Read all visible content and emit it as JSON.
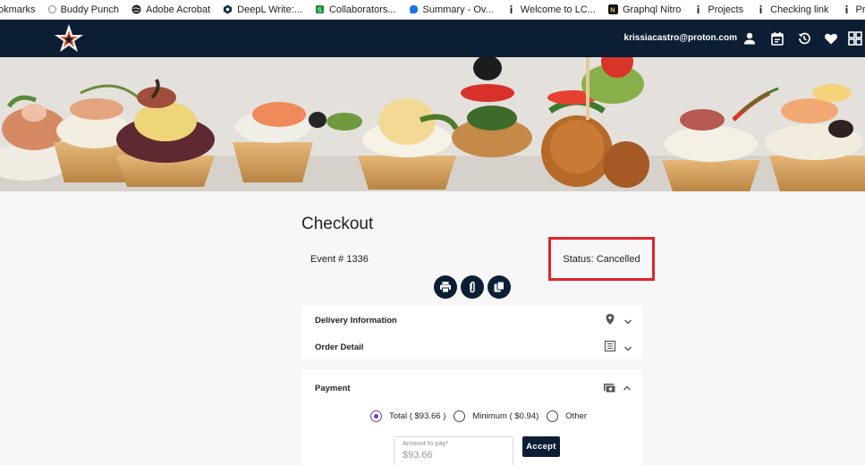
{
  "bookmarks": [
    {
      "label": "okmarks",
      "icon": "none",
      "color": ""
    },
    {
      "label": "Buddy Punch",
      "icon": "circle-icon",
      "color": "#8a8a8a"
    },
    {
      "label": "Adobe Acrobat",
      "icon": "globe-icon",
      "color": "#202124"
    },
    {
      "label": "DeepL Write:...",
      "icon": "deepl-icon",
      "color": "#0f2b46"
    },
    {
      "label": "Collaborators...",
      "icon": "collab-icon",
      "color": "#1e8e3e"
    },
    {
      "label": "Summary - Ov...",
      "icon": "summary-icon",
      "color": "#1a73e8"
    },
    {
      "label": "Welcome to LC...",
      "icon": "info-icon",
      "color": "#202124"
    },
    {
      "label": "Graphql Nitro",
      "icon": "nitro-icon",
      "color": "#111111"
    },
    {
      "label": "Projects",
      "icon": "info-icon",
      "color": "#202124"
    },
    {
      "label": "Checking link",
      "icon": "info-icon",
      "color": "#202124"
    },
    {
      "label": "Project Manag...",
      "icon": "info-icon",
      "color": "#202124"
    }
  ],
  "nav": {
    "user_email": "krissiacastro@proton.com",
    "brand_color": "#0b1e33"
  },
  "checkout": {
    "title": "Checkout",
    "event_number": "Event # 1336",
    "status": "Status: Cancelled",
    "status_highlight_color": "#e0242c"
  },
  "actions": [
    "print",
    "attachment",
    "copy"
  ],
  "panels": {
    "delivery": {
      "title": "Delivery Information"
    },
    "order": {
      "title": "Order Detail"
    },
    "payment": {
      "title": "Payment"
    }
  },
  "payment": {
    "options": [
      {
        "label": "Total ( $93.66 )",
        "checked": true
      },
      {
        "label": "Minimum ( $0.94)",
        "checked": false
      },
      {
        "label": "Other",
        "checked": false
      }
    ],
    "amount_label": "Amount to pay*",
    "amount_value": "$93.66",
    "accept_label": "Accept"
  }
}
